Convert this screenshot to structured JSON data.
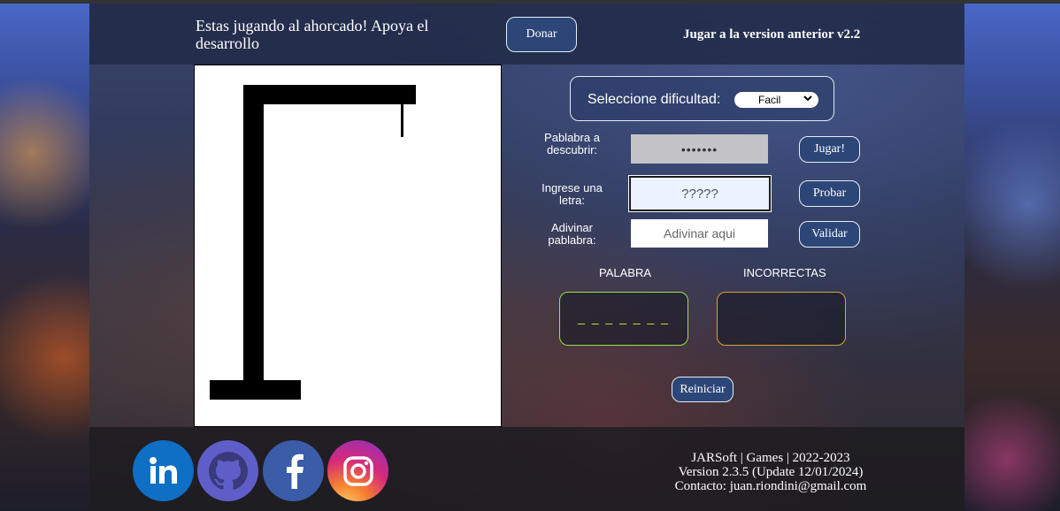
{
  "header": {
    "title": "Estas jugando al ahorcado! Apoya el desarrollo",
    "donate_label": "Donar",
    "previous_version_link": "Jugar a la version anterior v2.2"
  },
  "difficulty": {
    "label": "Seleccione dificultad:",
    "selected": "Facil"
  },
  "form": {
    "secret_label": "Pablabra a descubrir:",
    "secret_value": "•••••••",
    "letter_label": "Ingrese una letra:",
    "letter_placeholder": "?????",
    "guess_label": "Adivinar pablabra:",
    "guess_placeholder": "Adivinar aqui",
    "play_label": "Jugar!",
    "try_label": "Probar",
    "validate_label": "Validar"
  },
  "results": {
    "word_heading": "PALABRA",
    "word_display": "_ _ _ _ _ _ _",
    "wrong_heading": "INCORRECTAS",
    "wrong_letters": ""
  },
  "restart_label": "Reiniciar",
  "footer": {
    "line1": "JARSoft | Games | 2022-2023",
    "line2": "Version 2.3.5 (Update 12/01/2024)",
    "line3": "Contacto: juan.riondini@gmail.com",
    "social": [
      "linkedin-icon",
      "github-icon",
      "facebook-icon",
      "instagram-icon"
    ]
  },
  "colors": {
    "button_bg": "#2c4677",
    "word_box_border": "#9be04c",
    "wrong_box_border": "#d9a33a"
  }
}
